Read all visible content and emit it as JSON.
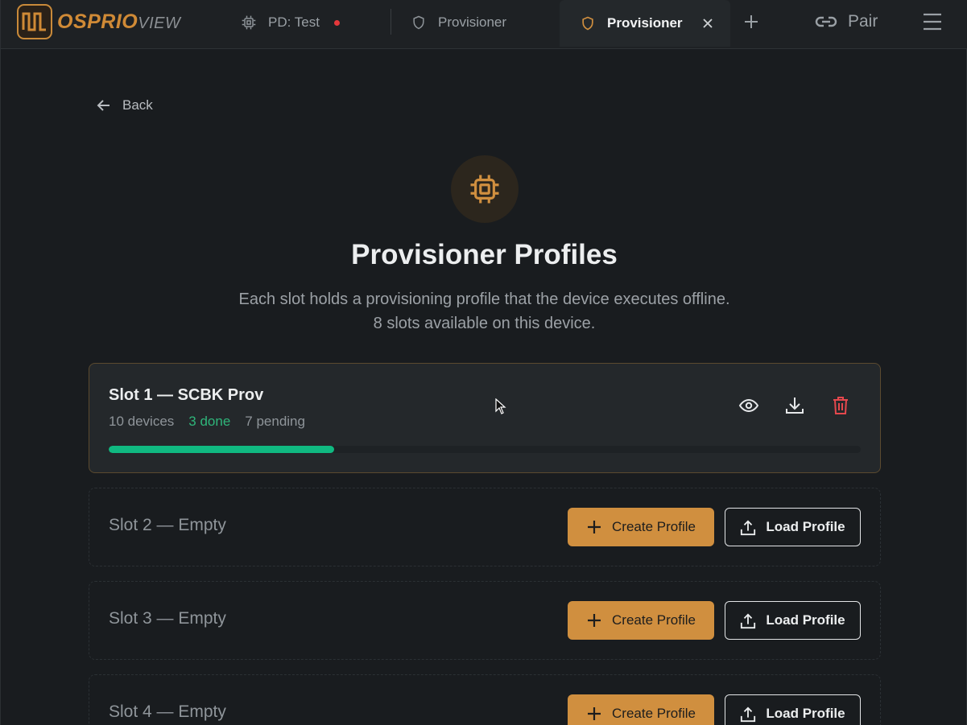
{
  "app": {
    "brand_bold": "OSPRIO",
    "brand_light": "VIEW"
  },
  "tabs": [
    {
      "label": "PD: Test",
      "icon": "chip-icon",
      "status_color": "#e5383b"
    },
    {
      "label": "Provisioner",
      "icon": "shield-icon"
    },
    {
      "label": "Provisioner",
      "icon": "shield-icon",
      "active": true
    }
  ],
  "topbar": {
    "pair_label": "Pair"
  },
  "nav": {
    "back_label": "Back"
  },
  "page": {
    "title": "Provisioner Profiles",
    "subtitle_line1": "Each slot holds a provisioning profile that the device executes offline.",
    "subtitle_line2": "8 slots available on this device."
  },
  "slots": [
    {
      "name": "Slot 1 — SCBK Prov",
      "devices": "10 devices",
      "done": "3 done",
      "pending": "7 pending",
      "progress": 0.3
    },
    {
      "name": "Slot 2 — Empty"
    },
    {
      "name": "Slot 3 — Empty"
    },
    {
      "name": "Slot 4 — Empty"
    }
  ],
  "buttons": {
    "create_label": "Create Profile",
    "load_label": "Load Profile"
  },
  "colors": {
    "accent": "#d08f3f",
    "success": "#10b981",
    "danger": "#e5484d",
    "background": "#191c1f"
  }
}
